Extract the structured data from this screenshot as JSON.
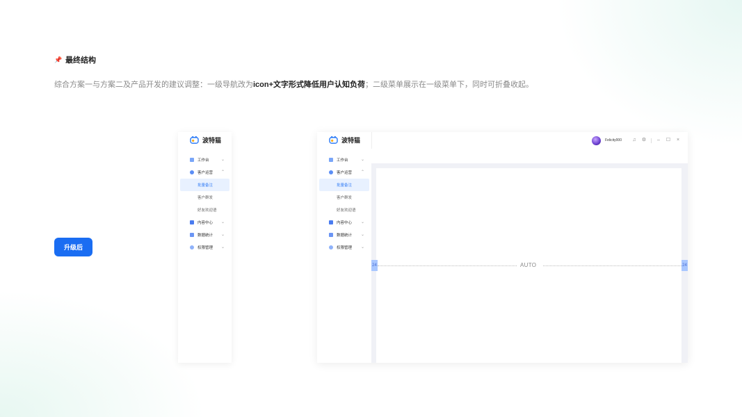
{
  "heading": {
    "pin": "📌",
    "title": "最终结构"
  },
  "description": {
    "part1": "综合方案一与方案二及产品开发的建议调整：一级导航改为",
    "strong": "icon+文字形式降低用户认知负荷",
    "part2": "；二级菜单展示在一级菜单下，同时可折叠收起。"
  },
  "upgrade_button": "升级后",
  "brand": {
    "name": "波特猫"
  },
  "nav": {
    "items": [
      {
        "label": "工作台",
        "icon": "desk-icon",
        "chevron": "⌄"
      },
      {
        "label": "客户运营",
        "icon": "customer-icon",
        "chevron": "⌃"
      },
      {
        "label": "内容中心",
        "icon": "content-icon",
        "chevron": "⌄"
      },
      {
        "label": "数据统计",
        "icon": "data-icon",
        "chevron": "⌄"
      },
      {
        "label": "权限管理",
        "icon": "permission-icon",
        "chevron": "⌄"
      }
    ],
    "sub_items": [
      {
        "label": "批量备注",
        "active": true
      },
      {
        "label": "客户群发",
        "active": false
      },
      {
        "label": "好友欢迎语",
        "active": false
      }
    ]
  },
  "topbar": {
    "username": "Felicity000",
    "icons": [
      "bell-icon",
      "gear-icon",
      "minimize-icon",
      "maximize-icon",
      "close-icon"
    ],
    "bell": "♫",
    "gear": "⚙",
    "minimize": "–",
    "maximize": "☐",
    "close": "×"
  },
  "content": {
    "left_margin": "24",
    "right_margin": "24",
    "auto_label": "AUTO"
  },
  "colors": {
    "primary": "#1a6df2",
    "active_bg": "#e8f1ff",
    "marker": "#a9c7ff"
  }
}
